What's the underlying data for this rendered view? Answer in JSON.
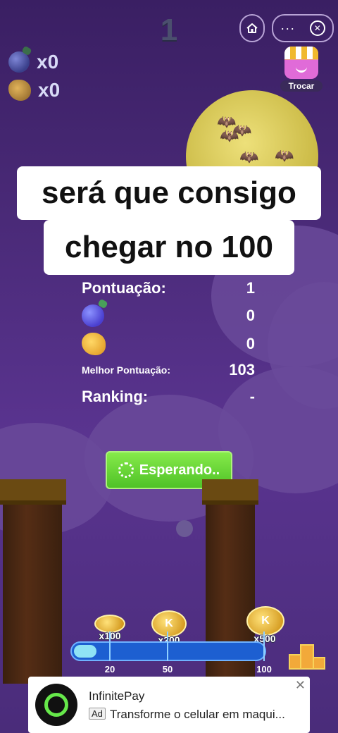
{
  "game": {
    "current_score": "1",
    "berries_count": "x0",
    "popcorn_count": "x0"
  },
  "icons": {
    "home": "home-icon",
    "more": "more-icon",
    "close": "close-icon",
    "shop": "shop-icon",
    "berry": "blueberry-icon",
    "popcorn": "popcorn-icon",
    "spinner": "spinner-icon",
    "coin": "coin-icon",
    "trophy": "trophy-podium-icon"
  },
  "header": {
    "menu_dots": "···",
    "close_glyph": "✕",
    "shop_label": "Trocar"
  },
  "caption": {
    "line1": "será que consigo",
    "line2": "chegar no 100"
  },
  "stats": {
    "score_label": "Pontuação:",
    "score_value": "1",
    "berries_value": "0",
    "popcorn_value": "0",
    "best_label": "Melhor  Pontuação:",
    "best_value": "103",
    "ranking_label": "Ranking:",
    "ranking_value": "-"
  },
  "wait_button": {
    "label": "Esperando.."
  },
  "rewards": {
    "r1": "x100",
    "r2": "x200",
    "r3": "x500",
    "coin_letter": "K",
    "progress_ratio": 0.12,
    "milestones": [
      "20",
      "50",
      "100"
    ]
  },
  "ad": {
    "title": "InfinitePay",
    "badge": "Ad",
    "text": "Transforme o celular em maqui...",
    "close": "✕"
  },
  "colors": {
    "background": "#4a2a78",
    "moon": "#e6d870",
    "green_button": "#5ccb2e",
    "progress": "#1d5fd1",
    "ad_logo_ring": "#66e84a"
  }
}
